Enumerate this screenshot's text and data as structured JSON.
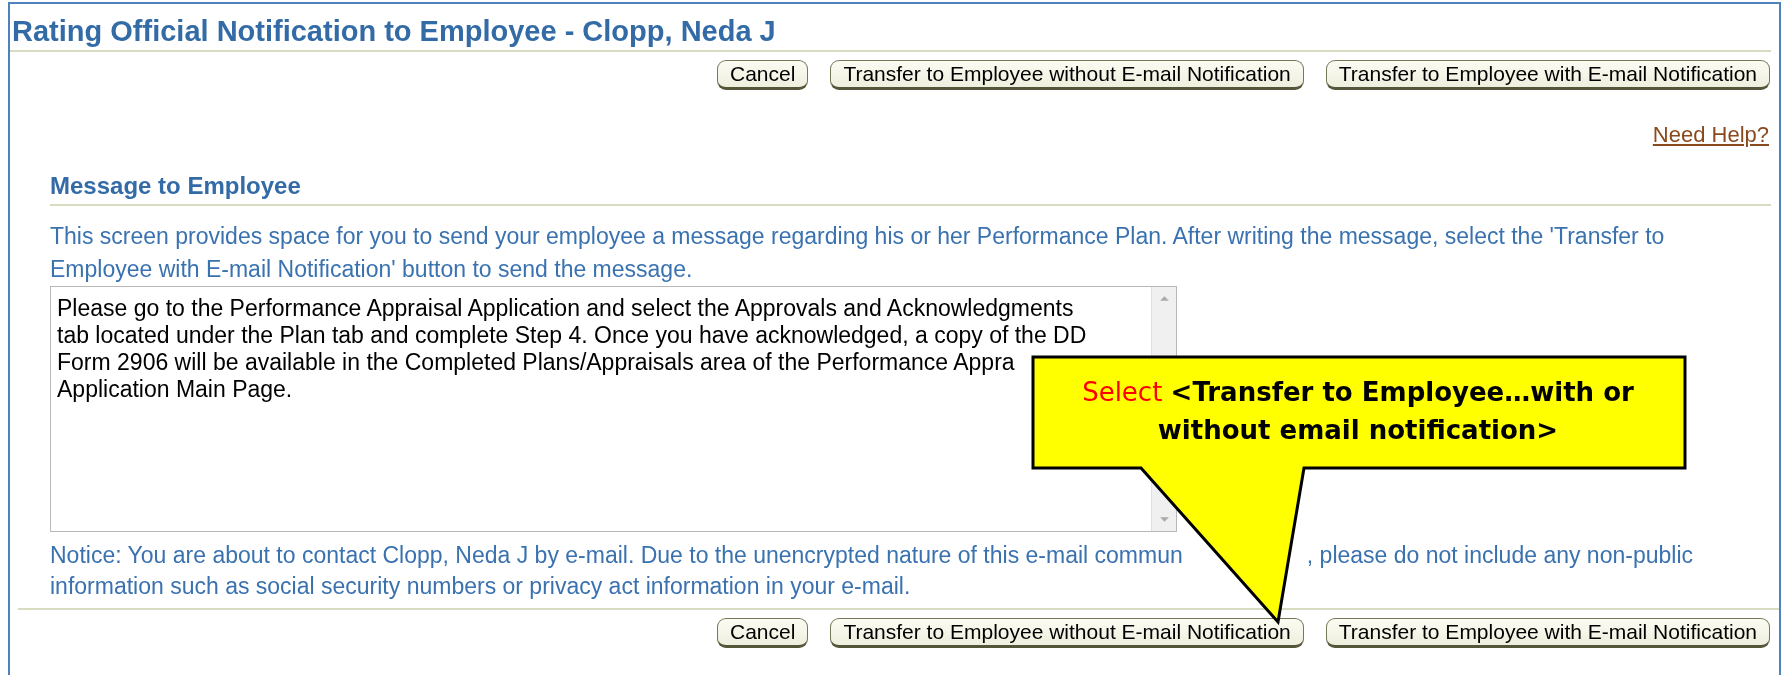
{
  "page": {
    "title": "Rating Official Notification to Employee - Clopp, Neda J"
  },
  "top_buttons": [
    "Cancel",
    "Transfer to Employee without E-mail Notification",
    "Transfer to Employee with E-mail Notification"
  ],
  "help_link": "Need Help?",
  "section": {
    "heading": "Message to Employee",
    "instructions": [
      "This screen provides space for you to send your employee a message regarding his or her Performance Plan. After writing the message, select the 'Transfer to",
      "Employee with E-mail Notification' button to send the message."
    ],
    "message_lines": [
      "Please go to the Performance Appraisal Application and select the Approvals and Acknowledgments",
      "tab located under the Plan tab and complete Step 4.  Once you have acknowledged, a copy of the DD",
      "Form 2906 will be available in the Completed Plans/Appraisals area of the Performance Appra",
      "Application Main Page."
    ],
    "notice_lines": [
      [
        "Notice: You are about to contact Clopp, Neda J by e-mail. Due to the unencrypted nature of this e-mail commun",
        ", please do not include any non-public"
      ],
      [
        "information such as social security numbers or privacy act information in your e-mail."
      ]
    ]
  },
  "bottom_buttons": [
    "Cancel",
    "Transfer to Employee without E-mail Notification",
    "Transfer to Employee with E-mail Notification"
  ],
  "callout": {
    "text": "Select **<Transfer to Employee…with or without email notification>**"
  }
}
